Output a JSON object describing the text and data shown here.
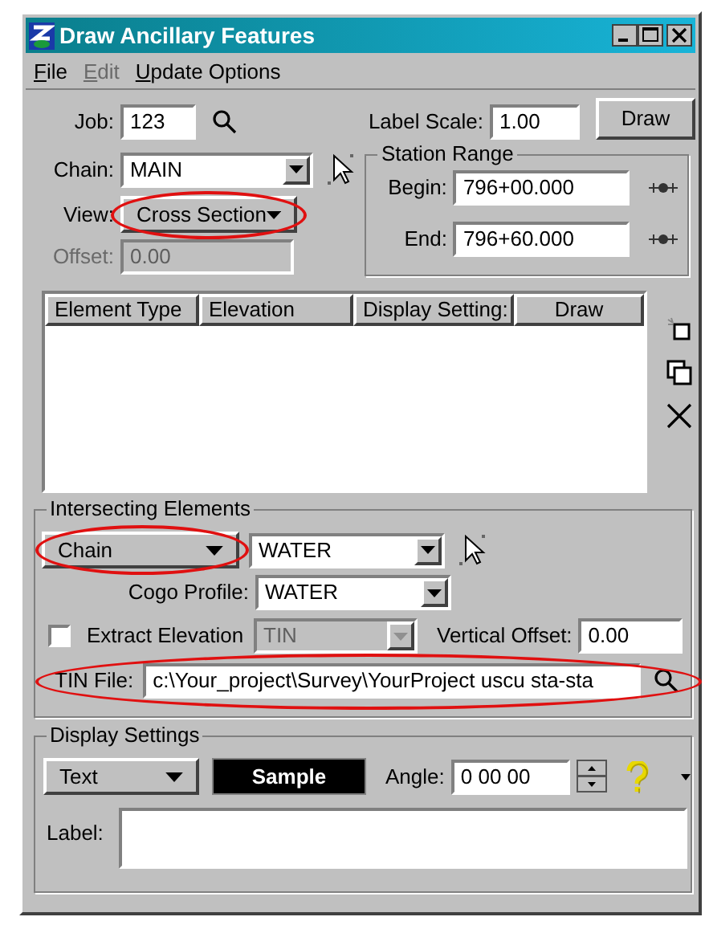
{
  "window": {
    "title": "Draw Ancillary Features"
  },
  "menu": [
    {
      "label": "File",
      "disabled": false
    },
    {
      "label": "Edit",
      "disabled": true
    },
    {
      "label": "Update Options",
      "disabled": false
    }
  ],
  "job": {
    "label": "Job:",
    "value": "123"
  },
  "label_scale": {
    "label": "Label Scale:",
    "value": "1.00"
  },
  "draw_button": {
    "label": "Draw"
  },
  "chain": {
    "label": "Chain:",
    "value": "MAIN"
  },
  "view": {
    "label": "View:",
    "value": "Cross Section",
    "highlighted": true
  },
  "offset": {
    "label": "Offset:",
    "value": "0.00",
    "disabled": true
  },
  "station_range": {
    "title": "Station Range",
    "begin": {
      "label": "Begin:",
      "value": "796+00.000"
    },
    "end": {
      "label": "End:",
      "value": "796+60.000"
    }
  },
  "table": {
    "columns": [
      "Element Type",
      "Elevation",
      "Display Setting:",
      "Draw"
    ]
  },
  "intersecting": {
    "title": "Intersecting Elements",
    "element_type": {
      "value": "Chain",
      "highlighted": true
    },
    "chain": {
      "value": "WATER"
    },
    "cogo_profile": {
      "label": "Cogo Profile:",
      "value": "WATER"
    },
    "extract_elevation": {
      "label": "Extract Elevation",
      "checked": false
    },
    "elevation_source": {
      "value": "TIN",
      "disabled": true
    },
    "vertical_offset": {
      "label": "Vertical Offset:",
      "value": "0.00"
    },
    "tin_file": {
      "label": "TIN File:",
      "value": "c:\\Your_project\\Survey\\YourProject uscu sta-sta",
      "highlighted": true
    }
  },
  "display_settings": {
    "title": "Display Settings",
    "symbology": {
      "value": "Text"
    },
    "sample": {
      "label": "Sample"
    },
    "angle": {
      "label": "Angle:",
      "value": "0 00 00"
    },
    "label": {
      "label": "Label:"
    }
  }
}
